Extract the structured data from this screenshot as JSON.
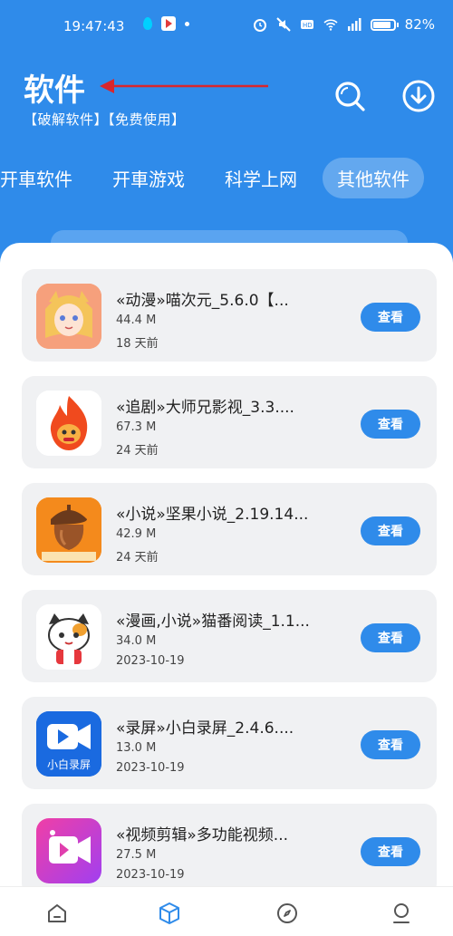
{
  "status_bar": {
    "time": "19:47:43",
    "battery": "82%"
  },
  "header": {
    "title": "软件",
    "subtitle": "【破解软件】【免费使用】"
  },
  "tabs": [
    {
      "label": "开車软件"
    },
    {
      "label": "开車游戏"
    },
    {
      "label": "科学上网"
    },
    {
      "label": "其他软件",
      "active": true
    }
  ],
  "apps": [
    {
      "name": "«动漫»喵次元_5.6.0【...",
      "size": "44.4 M",
      "date": "18 天前",
      "button": "查看",
      "icon": "anime-girl-icon"
    },
    {
      "name": "«追剧»大师兄影视_3.3....",
      "size": "67.3 M",
      "date": "24 天前",
      "button": "查看",
      "icon": "flame-monkey-icon"
    },
    {
      "name": "«小说»坚果小说_2.19.14...",
      "size": "42.9 M",
      "date": "24 天前",
      "button": "查看",
      "icon": "acorn-icon"
    },
    {
      "name": "«漫画,小说»猫番阅读_1.1...",
      "size": "34.0 M",
      "date": "2023-10-19",
      "button": "查看",
      "icon": "cat-icon"
    },
    {
      "name": "«录屏»小白录屏_2.4.6....",
      "size": "13.0 M",
      "date": "2023-10-19",
      "button": "查看",
      "icon": "video-camera-icon",
      "icon_text": "小白录屏"
    },
    {
      "name": "«视频剪辑»多功能视频...",
      "size": "27.5 M",
      "date": "2023-10-19",
      "button": "查看",
      "icon": "video-editor-icon"
    }
  ],
  "colors": {
    "primary": "#2f8bea",
    "card_bg": "#f0f1f3",
    "arrow": "#d9262c"
  },
  "bottom_nav": [
    "home-icon",
    "cube-icon",
    "compass-icon",
    "profile-icon"
  ]
}
